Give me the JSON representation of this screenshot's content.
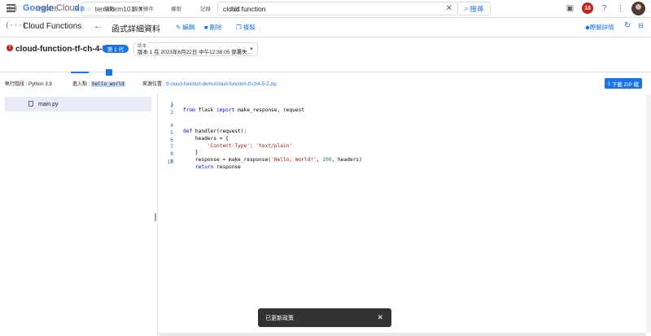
{
  "topbar": {
    "logo_google": "Google",
    "logo_cloud": "Cloud",
    "project": "terraform101",
    "search_value": "cloud function",
    "search_button": "搜尋",
    "notification_count": "18"
  },
  "header": {
    "section_title": "Cloud Functions",
    "page_title": "函式詳細資料",
    "actions": [
      "編輯",
      "刪除",
      "複製"
    ],
    "learn_label": "瞭解詳情"
  },
  "function": {
    "name": "cloud-function-tf-ch-4-5-2",
    "generation_badge": "第 1 代",
    "version_label": "版本",
    "version_value": "版本 1 在 2023年6月22日 中午12:38:05 部署失..."
  },
  "tabs": [
    "指標",
    "詳細資訊",
    "來源",
    "變數",
    "觸發條件",
    "權限",
    "記錄",
    "測試"
  ],
  "active_tab": "來源",
  "info": {
    "runtime_label": "執行階段 :",
    "runtime_value": "Python 3.9",
    "entry_label": "進入點 :",
    "entry_value": "hello_world",
    "source_label": "來源位置 :",
    "source_value": "tf-cloud-function-demo/cloud-function-tf-ch4-5-2.zip",
    "download_label": "下載 ZIP 檔"
  },
  "files": [
    "main.py"
  ],
  "code_lines": [
    {
      "n": "1",
      "text": ""
    },
    {
      "n": "2",
      "text": ""
    },
    {
      "n": "3",
      "text": ""
    },
    {
      "n": "4",
      "text": ""
    },
    {
      "n": "5",
      "text": ""
    },
    {
      "n": "6",
      "text": ""
    },
    {
      "n": "7",
      "text": ""
    },
    {
      "n": "8",
      "text": ""
    },
    {
      "n": "9",
      "text": ""
    },
    {
      "n": "10",
      "text": ""
    }
  ],
  "code": {
    "l1_kw1": "from",
    "l1_mid": " flask ",
    "l1_kw2": "import",
    "l1_rest": " make_response, request",
    "l4_kw": "def",
    "l4_rest": " handler(request):",
    "l5": "    headers = {",
    "l6_indent": "        ",
    "l6_s1": "'Content-Type'",
    "l6_colon": ": ",
    "l6_s2": "'text/plain'",
    "l7": "    }",
    "l8_a": "    response = make_response(",
    "l8_s": "'Hello, World!'",
    "l8_b": ", ",
    "l8_n": "200",
    "l8_c": ", headers)",
    "l9_indent": "    ",
    "l9_kw": "return",
    "l9_rest": " response"
  },
  "toast": {
    "message": "已更新政策"
  }
}
